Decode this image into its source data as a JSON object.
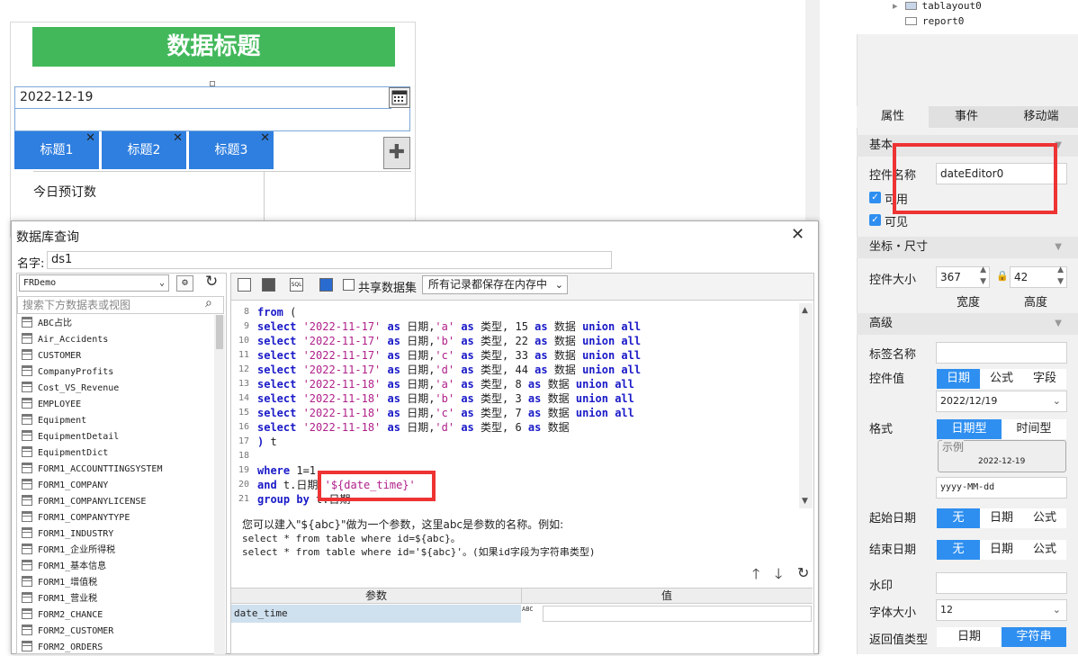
{
  "canvas": {
    "title": "数据标题",
    "date_value": "2022-12-19",
    "tabs": [
      "标题1",
      "标题2",
      "标题3"
    ],
    "close_glyph": "✕",
    "today_label": "今日预订数"
  },
  "tree": {
    "items": [
      "tablayout0",
      "report0"
    ]
  },
  "props": {
    "tabs": [
      "属性",
      "事件",
      "移动端"
    ],
    "basic_section": "基本",
    "name_label": "控件名称",
    "name_value": "dateEditor0",
    "enabled_label": "可用",
    "visible_label": "可见",
    "coord_section": "坐标・尺寸",
    "size_label": "控件大小",
    "width_value": "367",
    "height_value": "42",
    "width_caption": "宽度",
    "height_caption": "高度",
    "adv_section": "高级",
    "tag_label": "标签名称",
    "value_label": "控件值",
    "value_modes": [
      "日期",
      "公式",
      "字段"
    ],
    "value_date": "2022/12/19",
    "format_label": "格式",
    "format_modes": [
      "日期型",
      "时间型"
    ],
    "sample_label": "示例",
    "sample_value": "2022-12-19",
    "format_value": "yyyy-MM-dd",
    "start_label": "起始日期",
    "end_label": "结束日期",
    "range_modes": [
      "无",
      "日期",
      "公式"
    ],
    "watermark_label": "水印",
    "fontsize_label": "字体大小",
    "fontsize_value": "12",
    "return_label": "返回值类型",
    "return_modes": [
      "日期",
      "字符串"
    ],
    "accent": "#2f8ff0"
  },
  "dialog": {
    "title": "数据库查询",
    "name_label": "名字:",
    "name_value": "ds1",
    "datasource": "FRDemo",
    "search_placeholder": "搜索下方数据表或视图",
    "share_label": "共享数据集",
    "memory_option": "所有记录都保存在内存中",
    "tables": [
      "ABC占比",
      "Air_Accidents",
      "CUSTOMER",
      "CompanyProfits",
      "Cost_VS_Revenue",
      "EMPLOYEE",
      "Equipment",
      "EquipmentDetail",
      "EquipmentDict",
      "FORM1_ACCOUNTTINGSYSTEM",
      "FORM1_COMPANY",
      "FORM1_COMPANYLICENSE",
      "FORM1_COMPANYTYPE",
      "FORM1_INDUSTRY",
      "FORM1_企业所得税",
      "FORM1_基本信息",
      "FORM1_增值税",
      "FORM1_营业税",
      "FORM2_CHANCE",
      "FORM2_CUSTOMER",
      "FORM2_ORDERS"
    ],
    "code_lines": [
      {
        "n": "8",
        "parts": [
          [
            "kw",
            "from "
          ],
          [
            "",
            "("
          ]
        ]
      },
      {
        "n": "9",
        "parts": [
          [
            "kw",
            "select "
          ],
          [
            "st",
            "'2022-11-17'"
          ],
          [
            "kw",
            " as "
          ],
          [
            "",
            "日期,"
          ],
          [
            "st",
            "'a'"
          ],
          [
            "kw",
            " as "
          ],
          [
            "",
            "类型, 15 "
          ],
          [
            "kw",
            "as "
          ],
          [
            "",
            "数据 "
          ],
          [
            "kw",
            "union all"
          ]
        ]
      },
      {
        "n": "10",
        "parts": [
          [
            "kw",
            "select "
          ],
          [
            "st",
            "'2022-11-17'"
          ],
          [
            "kw",
            " as "
          ],
          [
            "",
            "日期,"
          ],
          [
            "st",
            "'b'"
          ],
          [
            "kw",
            " as "
          ],
          [
            "",
            "类型, 22 "
          ],
          [
            "kw",
            "as "
          ],
          [
            "",
            "数据 "
          ],
          [
            "kw",
            "union all"
          ]
        ]
      },
      {
        "n": "11",
        "parts": [
          [
            "kw",
            "select "
          ],
          [
            "st",
            "'2022-11-17'"
          ],
          [
            "kw",
            " as "
          ],
          [
            "",
            "日期,"
          ],
          [
            "st",
            "'c'"
          ],
          [
            "kw",
            " as "
          ],
          [
            "",
            "类型, 33 "
          ],
          [
            "kw",
            "as "
          ],
          [
            "",
            "数据 "
          ],
          [
            "kw",
            "union all"
          ]
        ]
      },
      {
        "n": "12",
        "parts": [
          [
            "kw",
            "select "
          ],
          [
            "st",
            "'2022-11-17'"
          ],
          [
            "kw",
            " as "
          ],
          [
            "",
            "日期,"
          ],
          [
            "st",
            "'d'"
          ],
          [
            "kw",
            " as "
          ],
          [
            "",
            "类型, 44 "
          ],
          [
            "kw",
            "as "
          ],
          [
            "",
            "数据 "
          ],
          [
            "kw",
            "union all"
          ]
        ]
      },
      {
        "n": "13",
        "parts": [
          [
            "kw",
            "select "
          ],
          [
            "st",
            "'2022-11-18'"
          ],
          [
            "kw",
            " as "
          ],
          [
            "",
            "日期,"
          ],
          [
            "st",
            "'a'"
          ],
          [
            "kw",
            " as "
          ],
          [
            "",
            "类型, 8 "
          ],
          [
            "kw",
            "as "
          ],
          [
            "",
            "数据 "
          ],
          [
            "kw",
            "union all"
          ]
        ]
      },
      {
        "n": "14",
        "parts": [
          [
            "kw",
            "select "
          ],
          [
            "st",
            "'2022-11-18'"
          ],
          [
            "kw",
            " as "
          ],
          [
            "",
            "日期,"
          ],
          [
            "st",
            "'b'"
          ],
          [
            "kw",
            " as "
          ],
          [
            "",
            "类型, 3 "
          ],
          [
            "kw",
            "as "
          ],
          [
            "",
            "数据 "
          ],
          [
            "kw",
            "union all"
          ]
        ]
      },
      {
        "n": "15",
        "parts": [
          [
            "kw",
            "select "
          ],
          [
            "st",
            "'2022-11-18'"
          ],
          [
            "kw",
            " as "
          ],
          [
            "",
            "日期,"
          ],
          [
            "st",
            "'c'"
          ],
          [
            "kw",
            " as "
          ],
          [
            "",
            "类型, 7 "
          ],
          [
            "kw",
            "as "
          ],
          [
            "",
            "数据 "
          ],
          [
            "kw",
            "union all"
          ]
        ]
      },
      {
        "n": "16",
        "parts": [
          [
            "kw",
            "select "
          ],
          [
            "st",
            "'2022-11-18'"
          ],
          [
            "kw",
            " as "
          ],
          [
            "",
            "日期,"
          ],
          [
            "st",
            "'d'"
          ],
          [
            "kw",
            " as "
          ],
          [
            "",
            "类型, 6 "
          ],
          [
            "kw",
            "as "
          ],
          [
            "",
            "数据"
          ]
        ]
      },
      {
        "n": "17",
        "parts": [
          [
            "kw",
            ") "
          ],
          [
            "",
            "t"
          ]
        ]
      },
      {
        "n": "18",
        "parts": []
      },
      {
        "n": "19",
        "parts": [
          [
            "kw",
            "where "
          ],
          [
            "",
            "1=1"
          ]
        ]
      },
      {
        "n": "20",
        "parts": [
          [
            "kw",
            "and "
          ],
          [
            "",
            "t.日期 "
          ],
          [
            "st",
            "'${date_time}'"
          ]
        ]
      },
      {
        "n": "21",
        "parts": [
          [
            "kw",
            "group by "
          ],
          [
            "",
            "t.日期"
          ]
        ]
      }
    ],
    "hint_lines": [
      "您可以建入\"${abc}\"做为一个参数，这里abc是参数的名称。例如:",
      "select * from table where id=${abc}。",
      "select * from table where id='${abc}'。(如果id字段为字符串类型)"
    ],
    "param_head": "参数",
    "value_head": "值",
    "param_name": "date_time",
    "param_type": "ABC"
  }
}
